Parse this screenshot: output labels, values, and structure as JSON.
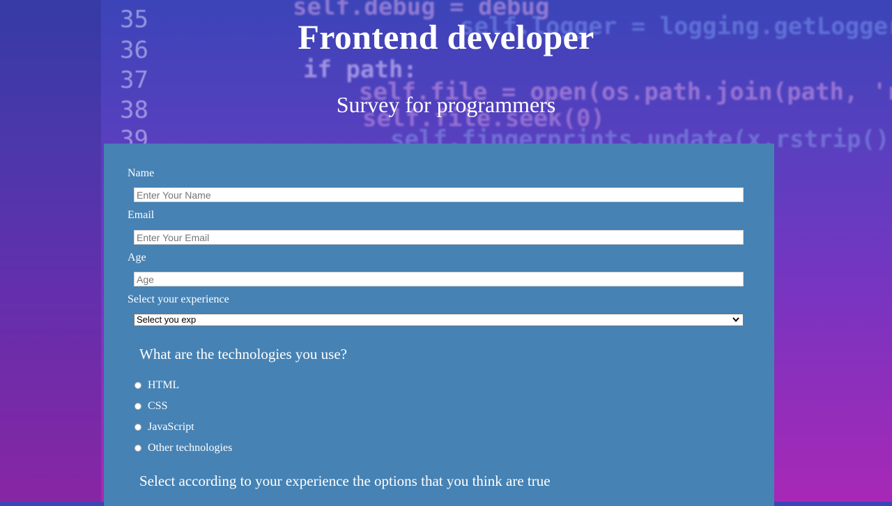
{
  "header": {
    "title": "Frontend developer",
    "subtitle": "Survey for programmers"
  },
  "form": {
    "name_label": "Name",
    "name_placeholder": "Enter Your Name",
    "email_label": "Email",
    "email_placeholder": "Enter Your Email",
    "age_label": "Age",
    "age_placeholder": "Age",
    "experience_label": "Select your experience",
    "experience_selected": "Select you exp",
    "technologies_question": "What are the technologies you use?",
    "technologies": [
      "HTML",
      "CSS",
      "JavaScript",
      "Other technologies"
    ],
    "experience_question": "Select according to your experience the options that you think are true"
  },
  "background": {
    "line_numbers": [
      "35",
      "36",
      "37",
      "38",
      "39"
    ],
    "code_lines": [
      "self.debug = debug",
      "self.logger = logging.getLogger(__name__)",
      "if path:",
      "self.file = open(os.path.join(path, 'requests",
      "self.file.seek(0)",
      "self.fingerprints.update(x.rstrip() for x"
    ]
  },
  "colors": {
    "panel": "#4682b4",
    "text": "#ffffff",
    "background_top": "#3b44b8",
    "background_bottom": "#a828b6"
  }
}
